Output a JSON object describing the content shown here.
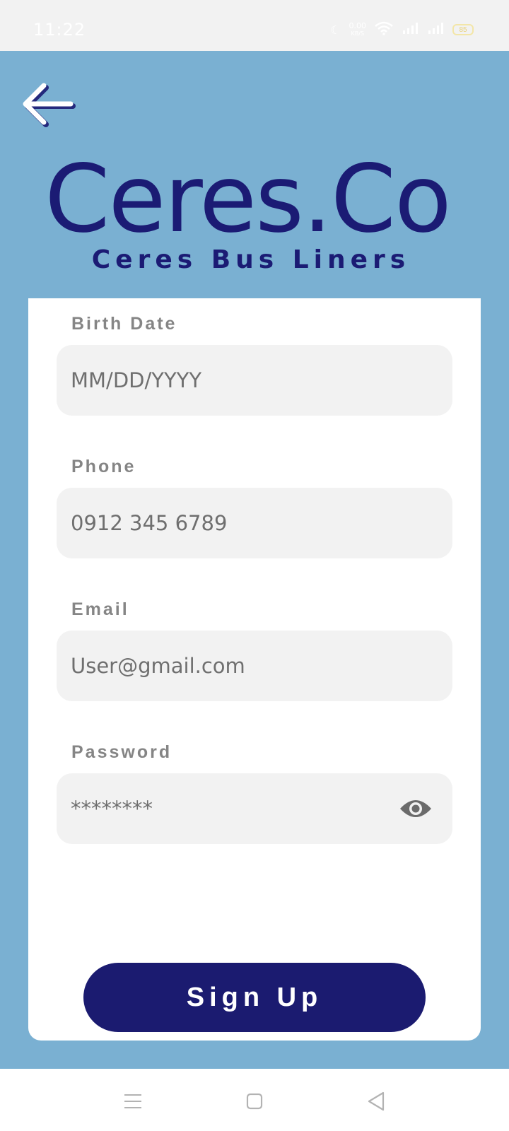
{
  "status_bar": {
    "time": "11:22",
    "net_speed_value": "0.00",
    "net_speed_unit": "KB/S",
    "battery": "85"
  },
  "header": {
    "brand_name": "Ceres.Co",
    "brand_tagline": "Ceres Bus Liners"
  },
  "form": {
    "birth_date": {
      "label": "Birth Date",
      "placeholder": "MM/DD/YYYY",
      "value": ""
    },
    "phone": {
      "label": "Phone",
      "placeholder": "0912 345 6789",
      "value": ""
    },
    "email": {
      "label": "Email",
      "placeholder": "User@gmail.com",
      "value": ""
    },
    "password": {
      "label": "Password",
      "placeholder": "********",
      "value": ""
    },
    "submit_label": "Sign Up"
  },
  "colors": {
    "background": "#7ab0d2",
    "brand": "#1b1b74",
    "field": "#f2f2f2",
    "label": "#858585"
  },
  "icons": {
    "back": "arrow-left-icon",
    "password_toggle": "eye-icon",
    "nav": [
      "menu-icon",
      "home-square-icon",
      "back-triangle-icon"
    ]
  }
}
